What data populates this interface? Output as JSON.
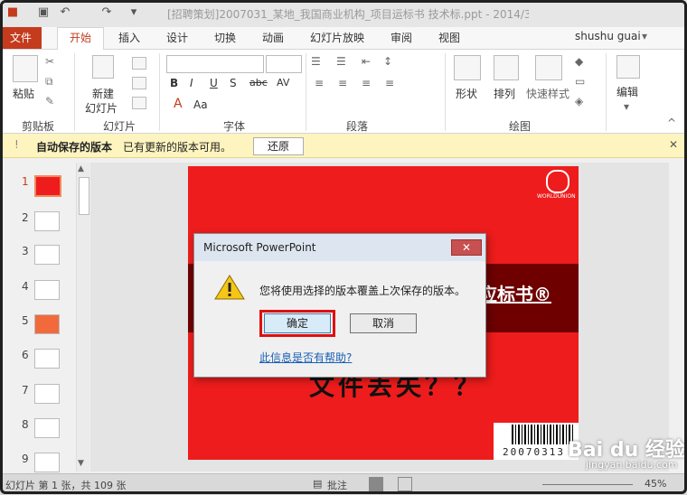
{
  "window": {
    "title": "[招聘策划]2007031_某地_我国商业机构_项目运标书 技术标.ppt - 2014/3/..."
  },
  "tabs": [
    "文件",
    "开始",
    "插入",
    "设计",
    "切换",
    "动画",
    "幻灯片放映",
    "审阅",
    "视图"
  ],
  "user": "shushu guai",
  "ribbon": {
    "paste": "粘贴",
    "new_slide_line1": "新建",
    "new_slide_line2": "幻灯片",
    "shape": "形状",
    "arrange": "排列",
    "quick_style": "快速样式",
    "edit": "编辑",
    "groups": {
      "clipboard": "剪贴板",
      "slides": "幻灯片",
      "font": "字体",
      "paragraph": "段落",
      "drawing": "绘图"
    },
    "font_buttons": [
      "B",
      "I",
      "U",
      "S",
      "abc",
      "AV",
      "Aa"
    ]
  },
  "notification": {
    "title": "自动保存的版本",
    "message": "已有更新的版本可用。",
    "restore": "还原"
  },
  "thumbnails": [
    "1",
    "2",
    "3",
    "4",
    "5",
    "6",
    "7",
    "8",
    "9"
  ],
  "slide": {
    "title_fragment": "应标书®",
    "subtitle_fragment": "文件丢失？？",
    "logo_text": "WORLDUNION",
    "barcode_text": "20070313"
  },
  "dialog": {
    "title": "Microsoft PowerPoint",
    "close": "✕",
    "message": "您将使用选择的版本覆盖上次保存的版本。",
    "ok": "确定",
    "cancel": "取消",
    "help_link": "此信息是否有帮助?"
  },
  "status": {
    "slide_info": "幻灯片 第 1 张，共 109 张",
    "notes": "批注",
    "zoom": "45%"
  },
  "watermark": {
    "brand": "Bai du 经验",
    "url": "jingyan.baidu.com"
  },
  "colors": {
    "accent": "#c43b1d",
    "highlight": "#e01010",
    "slide_red": "#ee1c1c",
    "link": "#1a5fb4"
  }
}
